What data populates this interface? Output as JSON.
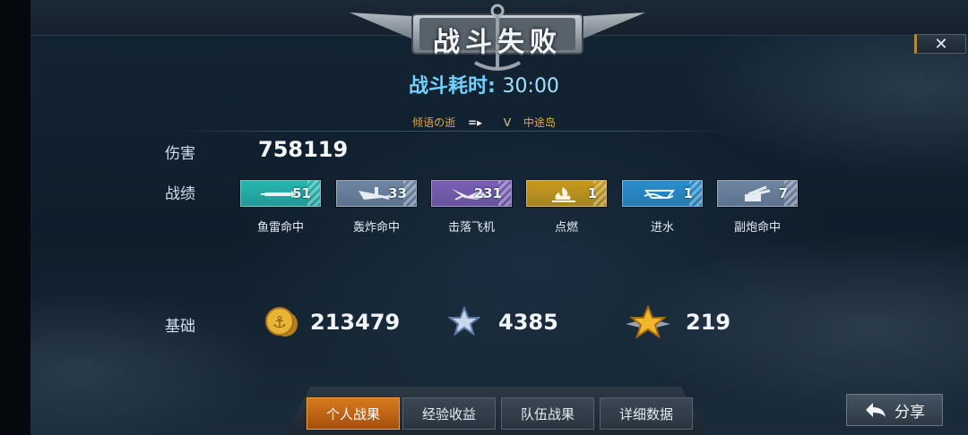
{
  "header": {
    "title": "战斗失败",
    "close_label": "✕"
  },
  "battle_duration": {
    "label": "战斗耗时:",
    "value": "30:00"
  },
  "route": {
    "player": "倾语の逝",
    "arrow": "=▸",
    "grade": "V",
    "location": "中途岛"
  },
  "damage": {
    "label": "伤害",
    "value": "758119"
  },
  "achievements": {
    "label": "战绩",
    "items": [
      {
        "label": "鱼雷命中",
        "count": "51",
        "icon": "torpedo-icon",
        "color": "#27b7b0"
      },
      {
        "label": "轰炸命中",
        "count": "33",
        "icon": "bomber-icon",
        "color": "#6f86a3"
      },
      {
        "label": "击落飞机",
        "count": "231",
        "icon": "plane-shot-icon",
        "color": "#7b5fb5"
      },
      {
        "label": "点燃",
        "count": "1",
        "icon": "fire-icon",
        "color": "#c99a1c"
      },
      {
        "label": "进水",
        "count": "1",
        "icon": "flood-icon",
        "color": "#2a8fcf"
      },
      {
        "label": "副炮命中",
        "count": "7",
        "icon": "secondary-gun-icon",
        "color": "#6f86a3"
      }
    ]
  },
  "base": {
    "label": "基础",
    "coins": {
      "value": "213479",
      "icon": "gold-coin-icon"
    },
    "exp": {
      "value": "4385",
      "icon": "silver-star-icon"
    },
    "merit": {
      "value": "219",
      "icon": "gold-star-icon"
    }
  },
  "tabs": [
    {
      "label": "个人战果",
      "active": true
    },
    {
      "label": "经验收益",
      "active": false
    },
    {
      "label": "队伍战果",
      "active": false
    },
    {
      "label": "详细数据",
      "active": false
    }
  ],
  "share": {
    "label": "分享",
    "icon": "back-arrow-icon"
  }
}
